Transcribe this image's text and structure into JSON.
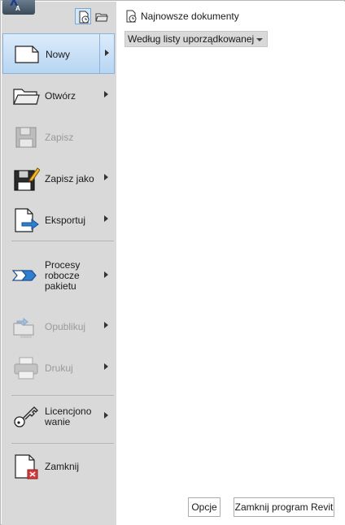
{
  "app": {
    "logo_letter": "A"
  },
  "menu": {
    "items": [
      {
        "id": "new",
        "label": "Nowy",
        "icon": "new-document-icon",
        "has_submenu": true,
        "disabled": false,
        "selected": true
      },
      {
        "id": "open",
        "label": "Otwórz",
        "icon": "open-folder-icon",
        "has_submenu": true,
        "disabled": false
      },
      {
        "id": "save",
        "label": "Zapisz",
        "icon": "floppy-disk-icon",
        "has_submenu": false,
        "disabled": true
      },
      {
        "id": "save_as",
        "label": "Zapisz jako",
        "icon": "save-as-icon",
        "has_submenu": true,
        "disabled": false
      },
      {
        "id": "export",
        "label": "Eksportuj",
        "icon": "export-icon",
        "has_submenu": true,
        "disabled": false
      },
      {
        "id": "suite",
        "label_lines": [
          "Procesy",
          "robocze",
          "pakietu"
        ],
        "icon": "suite-workflows-icon",
        "has_submenu": true,
        "disabled": false
      },
      {
        "id": "publish",
        "label": "Opublikuj",
        "icon": "publish-icon",
        "has_submenu": true,
        "disabled": true
      },
      {
        "id": "print",
        "label": "Drukuj",
        "icon": "printer-icon",
        "has_submenu": true,
        "disabled": true
      },
      {
        "id": "licensing",
        "label_lines": [
          "Licencjono",
          "wanie"
        ],
        "icon": "key-icon",
        "has_submenu": true,
        "disabled": false
      },
      {
        "id": "close",
        "label": "Zamknij",
        "icon": "close-document-icon",
        "has_submenu": false,
        "disabled": false
      }
    ]
  },
  "recent": {
    "title": "Najnowsze dokumenty",
    "sort_value": "Według listy uporządkowanej"
  },
  "footer": {
    "options_label": "Opcje",
    "exit_label": "Zamknij program Revit"
  },
  "colors": {
    "panel_bg": "#d9d9d9",
    "selected_bg": "#b7d5f2",
    "selected_border": "#8ab3dc",
    "export_arrow": "#2f7fd0",
    "close_badge": "#d83b3b"
  }
}
